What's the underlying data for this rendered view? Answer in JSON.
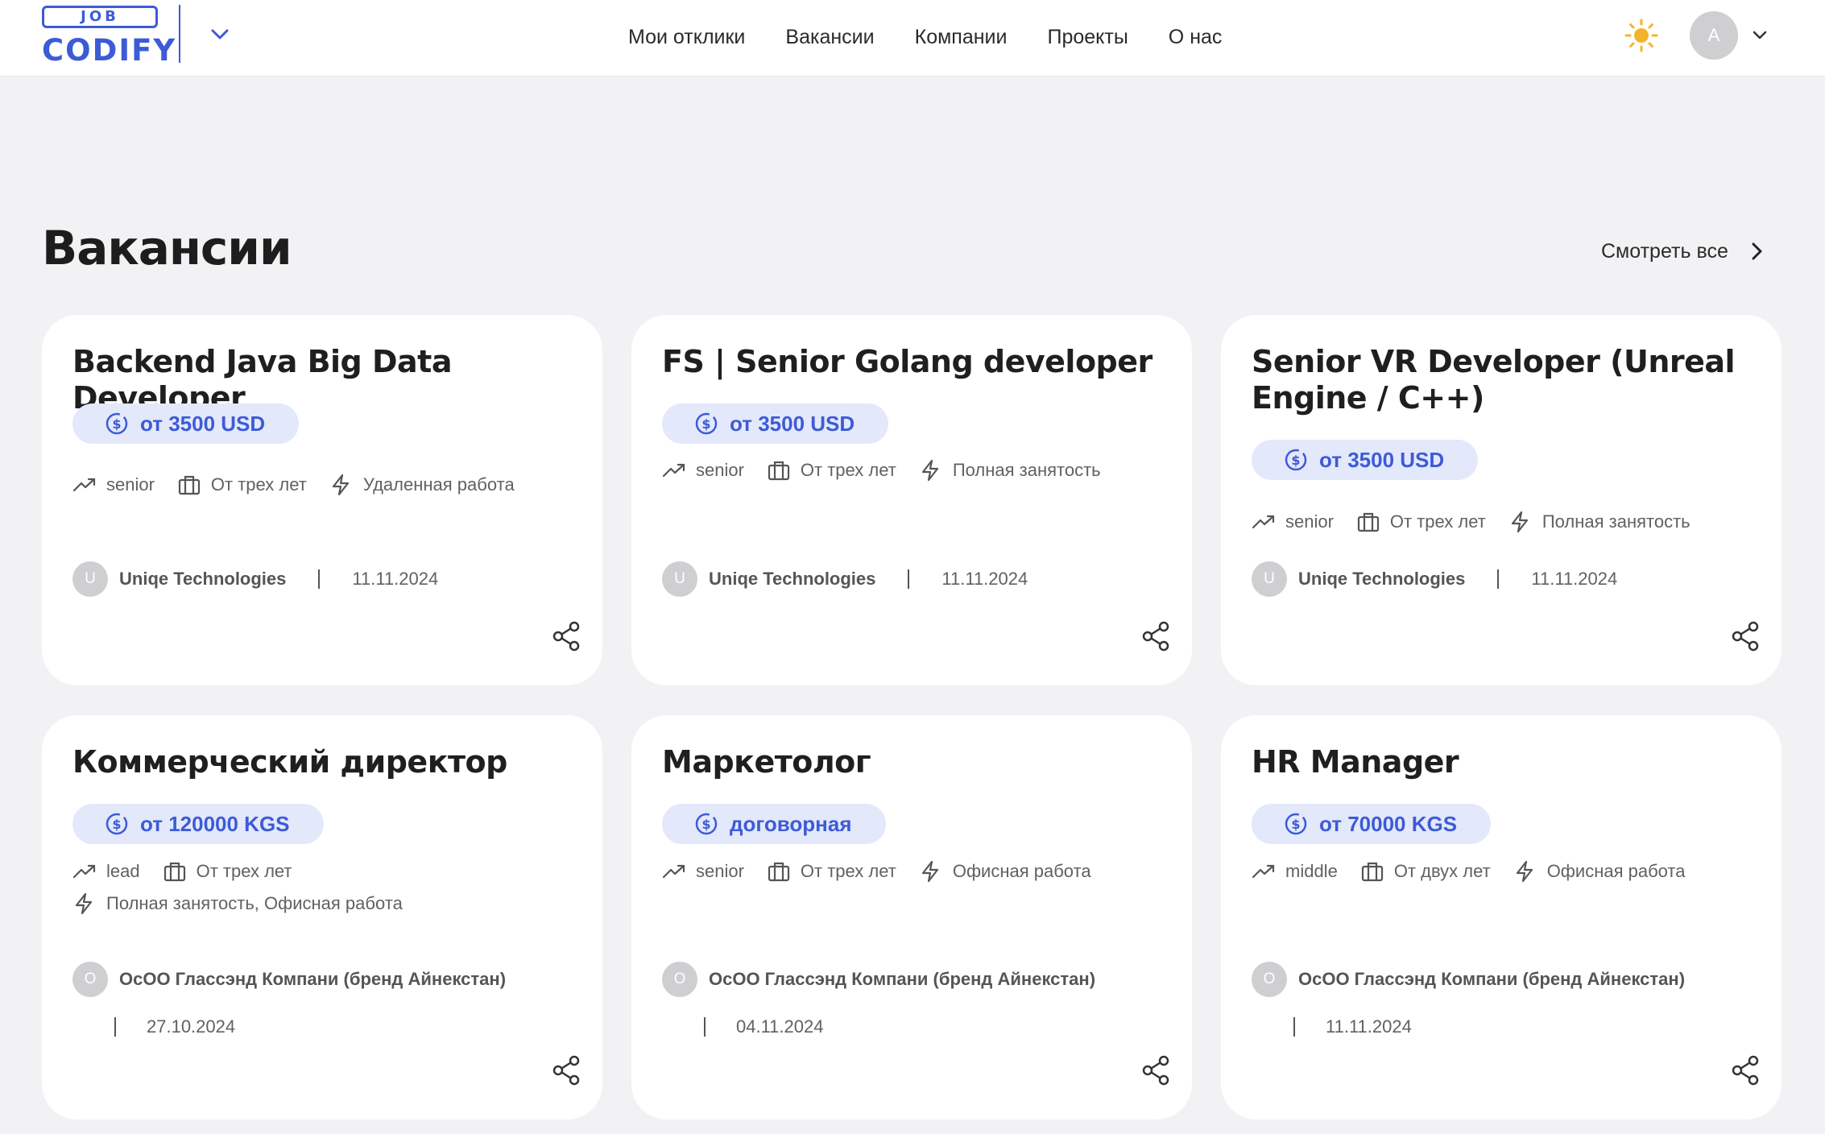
{
  "header": {
    "logo": {
      "top": "JOB",
      "bottom": "CODIFY"
    },
    "nav": [
      "Мои отклики",
      "Вакансии",
      "Компании",
      "Проекты",
      "О нас"
    ],
    "avatar_initial": "A",
    "theme_icon": "sun-icon",
    "accent_color": "#3d5bd6"
  },
  "section": {
    "title": "Вакансии",
    "see_all": "Смотреть все"
  },
  "cards": [
    {
      "title": "Backend Java Big Data Developer",
      "salary": "от 3500 USD",
      "level": "senior",
      "experience": "От трех лет",
      "work": "Удаленная работа",
      "company_initial": "U",
      "company": "Uniqe Technologies",
      "date": "11.11.2024"
    },
    {
      "title": "FS | Senior Golang developer",
      "salary": "от 3500 USD",
      "level": "senior",
      "experience": "От трех лет",
      "work": "Полная занятость",
      "company_initial": "U",
      "company": "Uniqe Technologies",
      "date": "11.11.2024"
    },
    {
      "title": "Senior VR Developer (Unreal Engine / C++)",
      "salary": "от 3500 USD",
      "level": "senior",
      "experience": "От трех лет",
      "work": "Полная занятость",
      "company_initial": "U",
      "company": "Uniqe Technologies",
      "date": "11.11.2024"
    },
    {
      "title": "Коммерческий директор",
      "salary": "от 120000 KGS",
      "level": "lead",
      "experience": "От трех лет",
      "work": "Полная занятость, Офисная работа",
      "company_initial": "О",
      "company": "ОсОО Глассэнд Компани (бренд Айнекстан)",
      "date": "27.10.2024"
    },
    {
      "title": "Маркетолог",
      "salary": "договорная",
      "level": "senior",
      "experience": "От трех лет",
      "work": "Офисная работа",
      "company_initial": "О",
      "company": "ОсОО Глассэнд Компани (бренд Айнекстан)",
      "date": "04.11.2024"
    },
    {
      "title": "HR Manager",
      "salary": "от 70000 KGS",
      "level": "middle",
      "experience": "От двух лет",
      "work": "Офисная работа",
      "company_initial": "О",
      "company": "ОсОО Глассэнд Компани (бренд Айнекстан)",
      "date": "11.11.2024"
    }
  ]
}
